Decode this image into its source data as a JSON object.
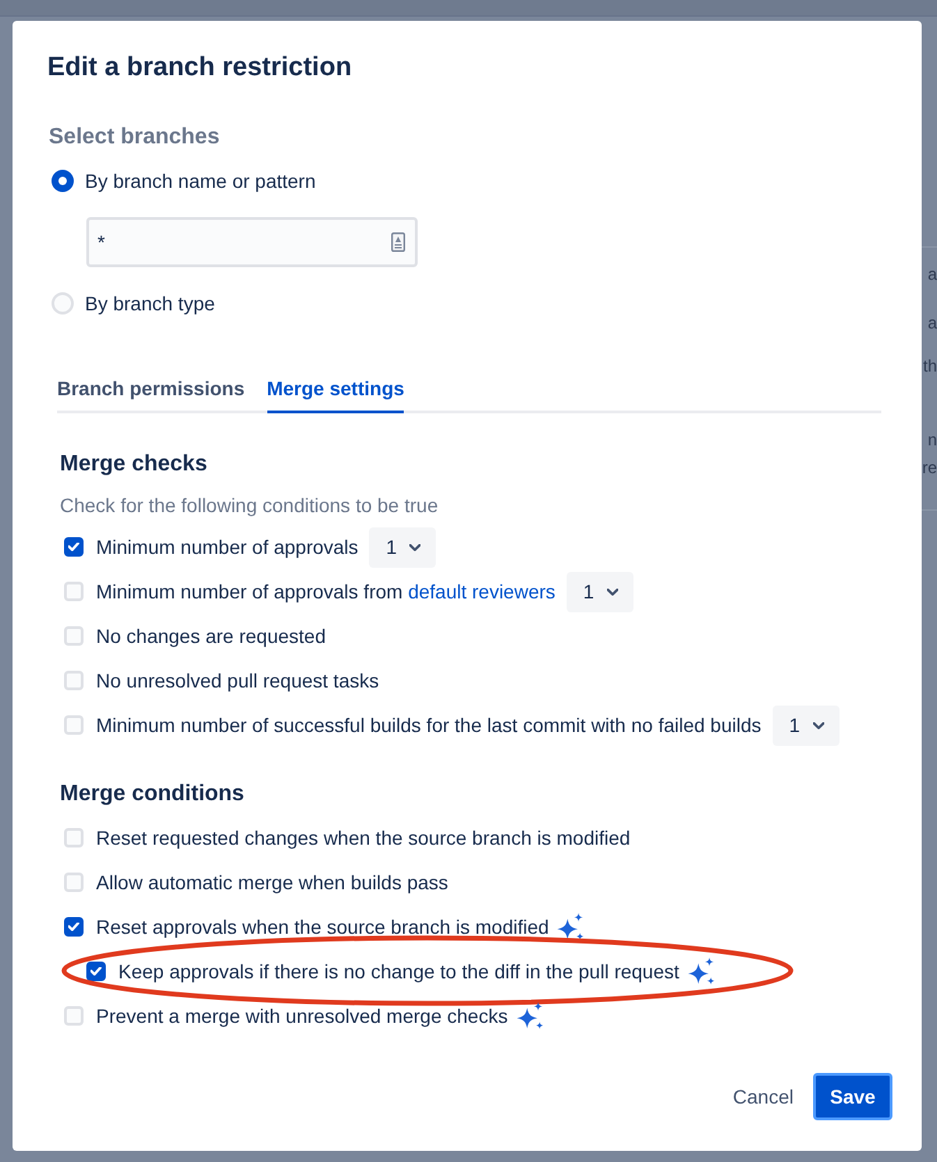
{
  "backdrop": {
    "text_fragments": [
      "a",
      "a",
      "th",
      "n",
      "re"
    ]
  },
  "dialog": {
    "title": "Edit a branch restriction"
  },
  "select_branches": {
    "heading": "Select branches",
    "options": [
      {
        "label": "By branch name or pattern",
        "selected": true,
        "field": {
          "value": "*"
        }
      },
      {
        "label": "By branch type",
        "selected": false
      }
    ]
  },
  "tabs": [
    {
      "label": "Branch permissions",
      "selected": false
    },
    {
      "label": "Merge settings",
      "selected": true
    }
  ],
  "merge_checks": {
    "heading": "Merge checks",
    "description": "Check for the following conditions to be true",
    "items": [
      {
        "label": "Minimum number of approvals",
        "checked": true,
        "dropdown": {
          "value": "1"
        }
      },
      {
        "label": "Minimum number of approvals from",
        "link": "default reviewers",
        "checked": false,
        "dropdown": {
          "value": "1"
        }
      },
      {
        "label": "No changes are requested",
        "checked": false
      },
      {
        "label": "No unresolved pull request tasks",
        "checked": false
      },
      {
        "label": "Minimum number of successful builds for the last commit with no failed builds",
        "checked": false,
        "dropdown": {
          "value": "1"
        }
      }
    ]
  },
  "merge_conditions": {
    "heading": "Merge conditions",
    "items": [
      {
        "label": "Reset requested changes when the source branch is modified",
        "checked": false,
        "ai_badge": false,
        "highlighted": false
      },
      {
        "label": "Allow automatic merge when builds pass",
        "checked": false,
        "ai_badge": false,
        "highlighted": false
      },
      {
        "label": "Reset approvals when the source branch is modified",
        "checked": true,
        "ai_badge": true,
        "highlighted": false,
        "children": [
          {
            "label": "Keep approvals if there is no change to the diff in the pull request",
            "checked": true,
            "ai_badge": true,
            "highlighted": true
          }
        ]
      },
      {
        "label": "Prevent a merge with unresolved merge checks",
        "checked": false,
        "ai_badge": true,
        "highlighted": false
      }
    ]
  },
  "footer": {
    "buttons": [
      {
        "label": "Cancel",
        "kind": "subtle",
        "focused": false
      },
      {
        "label": "Save",
        "kind": "primary",
        "focused": true
      }
    ]
  }
}
